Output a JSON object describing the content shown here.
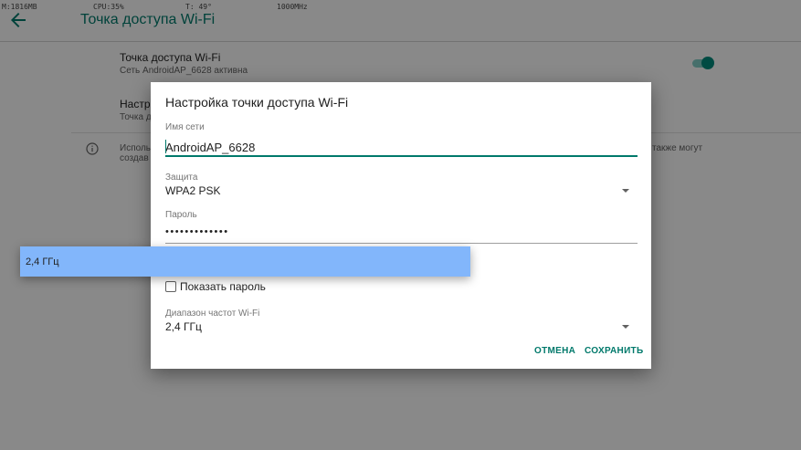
{
  "status_bar": {
    "mem": "M:1816MB",
    "cpu": "CPU:35%",
    "temp": "T: 49°",
    "freq": "1000MHz"
  },
  "app_bar": {
    "title": "Точка доступа Wi-Fi"
  },
  "settings": {
    "hotspot_title": "Точка доступа Wi-Fi",
    "hotspot_subtitle": "Сеть AndroidAP_6628 активна",
    "hotspot_enabled": true,
    "setup_title_partial": "Настр",
    "setup_subtitle_partial": "Точка д",
    "info_text_left_1": "Исполь",
    "info_text_left_2": "создав",
    "info_text_right": "также могут"
  },
  "dialog": {
    "title": "Настройка точки доступа Wi-Fi",
    "ssid_label": "Имя сети",
    "ssid_value": "AndroidAP_6628",
    "security_label": "Защита",
    "security_value": "WPA2 PSK",
    "password_label": "Пароль",
    "password_mask": "•••••••••••••",
    "show_password_label": "Показать пароль",
    "show_password_checked": false,
    "band_label": "Диапазон частот Wi-Fi",
    "band_value": "2,4 ГГц",
    "cancel_label": "ОТМЕНА",
    "save_label": "СОХРАНИТЬ"
  },
  "band_popup": {
    "options": [
      "2,4 ГГц"
    ],
    "highlight_color": "#82b6fb"
  },
  "colors": {
    "accent": "#00796b",
    "switch_thumb": "#00897b"
  },
  "icons": {
    "back": "arrow-left-icon",
    "info": "info-icon",
    "dropdown": "dropdown-arrow-icon"
  }
}
